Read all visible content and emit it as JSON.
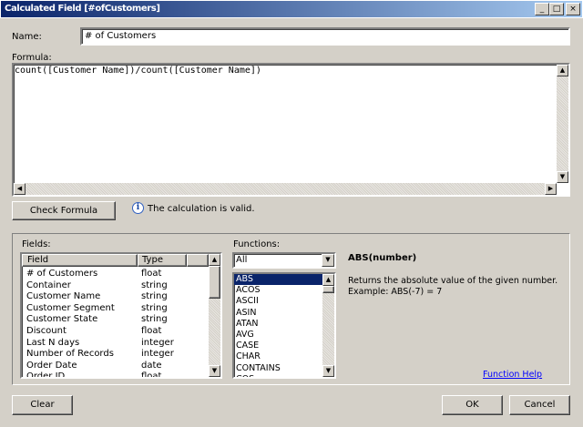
{
  "window": {
    "title": "Calculated Field [#ofCustomers]",
    "controls": [
      "_",
      "□",
      "×"
    ]
  },
  "name": {
    "label": "Name:",
    "value": "# of Customers"
  },
  "formula": {
    "label": "Formula:",
    "value": "count([Customer Name])/count([Customer Name])"
  },
  "check_formula_label": "Check Formula",
  "status": {
    "icon": "info-icon",
    "text": "The calculation is valid."
  },
  "fields": {
    "label": "Fields:",
    "columns": [
      "Field",
      "Type"
    ],
    "rows": [
      [
        "# of Customers",
        "float"
      ],
      [
        "Container",
        "string"
      ],
      [
        "Customer Name",
        "string"
      ],
      [
        "Customer Segment",
        "string"
      ],
      [
        "Customer State",
        "string"
      ],
      [
        "Discount",
        "float"
      ],
      [
        "Last N days",
        "integer"
      ],
      [
        "Number of Records",
        "integer"
      ],
      [
        "Order Date",
        "date"
      ],
      [
        "Order ID",
        "float"
      ]
    ]
  },
  "functions": {
    "label": "Functions:",
    "filter": "All",
    "items": [
      "ABS",
      "ACOS",
      "ASCII",
      "ASIN",
      "ATAN",
      "AVG",
      "CASE",
      "CHAR",
      "CONTAINS",
      "COS"
    ],
    "selected": "ABS"
  },
  "help": {
    "signature": "ABS(number)",
    "description": "Returns the absolute value of the given number.",
    "example": "Example: ABS(-7) = 7",
    "link": "Function Help"
  },
  "buttons": {
    "clear": "Clear",
    "ok": "OK",
    "cancel": "Cancel"
  }
}
